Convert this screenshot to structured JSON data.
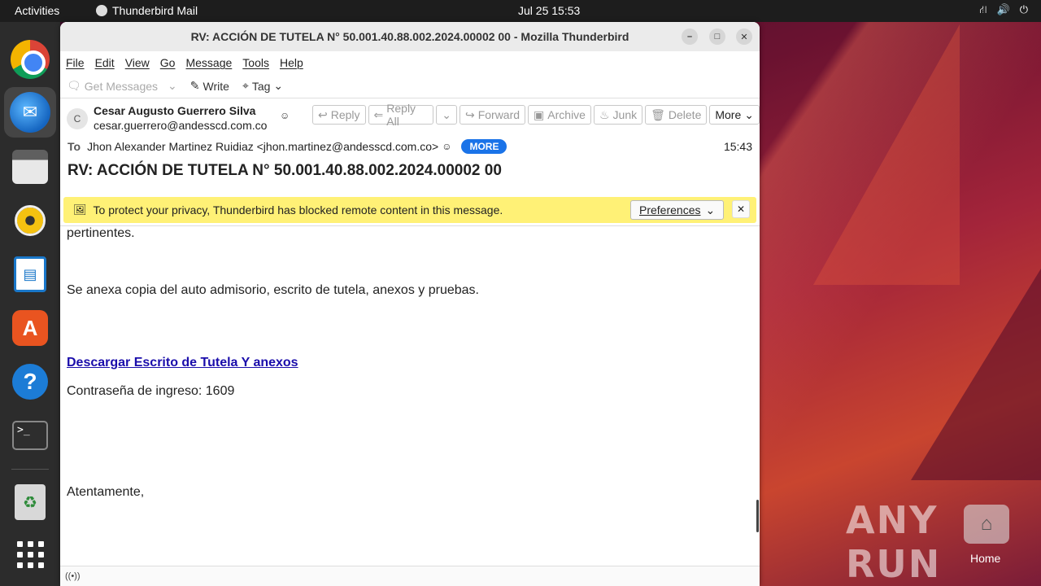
{
  "topbar": {
    "activities": "Activities",
    "app_name": "Thunderbird Mail",
    "clock": "Jul 25  15:53"
  },
  "window": {
    "title": "RV: ACCIÓN DE TUTELA N° 50.001.40.88.002.2024.00002 00 - Mozilla Thunderbird"
  },
  "menu": [
    "File",
    "Edit",
    "View",
    "Go",
    "Message",
    "Tools",
    "Help"
  ],
  "toolbar": {
    "get_messages": "Get Messages",
    "write": "Write",
    "tag": "Tag"
  },
  "message": {
    "avatar_letter": "C",
    "from_name": "Cesar Augusto Guerrero Silva",
    "from_email": "cesar.guerrero@andesscd.com.co",
    "actions": {
      "reply": "Reply",
      "reply_all": "Reply All",
      "forward": "Forward",
      "archive": "Archive",
      "junk": "Junk",
      "delete": "Delete",
      "more": "More"
    },
    "to_label": "To",
    "to_value": "Jhon Alexander Martinez Ruidiaz <jhon.martinez@andesscd.com.co>",
    "more_badge": "MORE",
    "time": "15:43",
    "subject": "RV: ACCIÓN DE TUTELA N° 50.001.40.88.002.2024.00002 00"
  },
  "notice": {
    "text": "To protect your privacy, Thunderbird has blocked remote content in this message.",
    "preferences": "Preferences"
  },
  "body": {
    "line1": "pertinentes.",
    "line2": "Se anexa copia del auto admisorio, escrito de tutela, anexos y pruebas.",
    "link": "Descargar Escrito de Tutela Y anexos",
    "password": "Contraseña de ingreso: 1609",
    "closing": "Atentamente,"
  },
  "desktop": {
    "watermark": "ANY RUN",
    "home_label": "Home"
  }
}
